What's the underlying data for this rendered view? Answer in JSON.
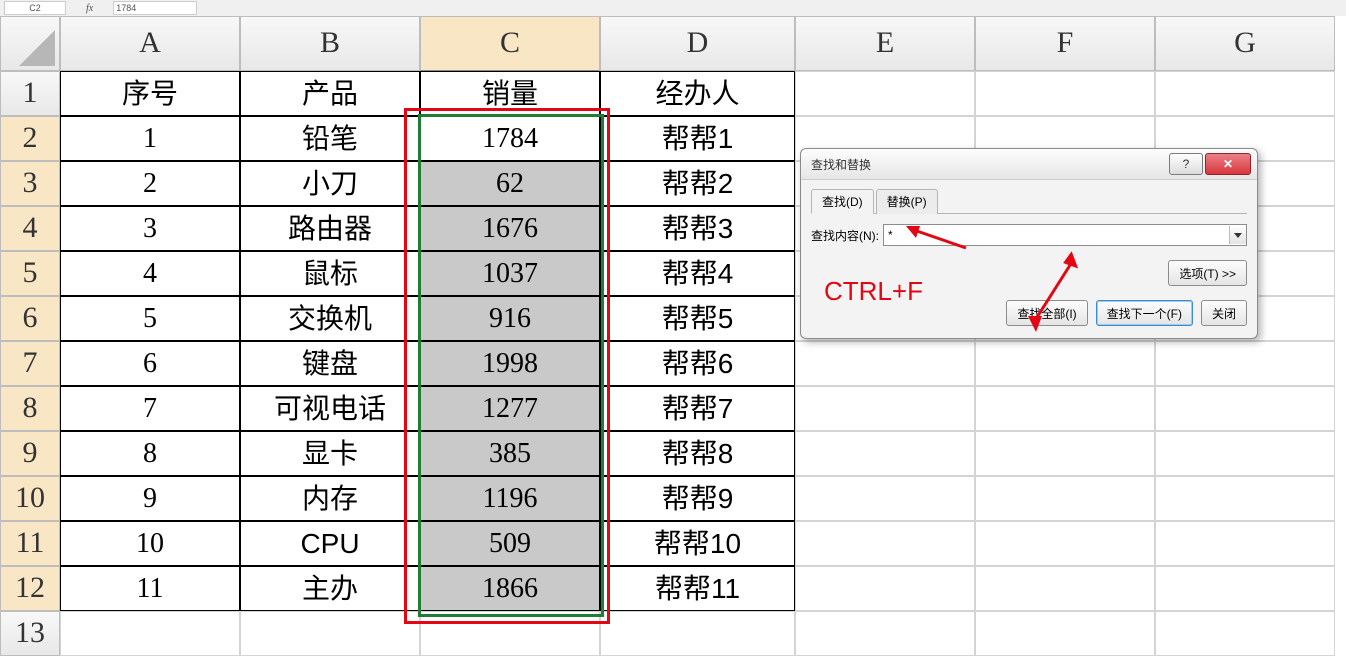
{
  "formula_bar": {
    "cell_ref": "C2",
    "fx_label": "fx",
    "formula_value": "1784"
  },
  "columns": [
    "A",
    "B",
    "C",
    "D",
    "E",
    "F",
    "G"
  ],
  "row_numbers": [
    1,
    2,
    3,
    4,
    5,
    6,
    7,
    8,
    9,
    10,
    11,
    12,
    13
  ],
  "table": {
    "headers": {
      "A": "序号",
      "B": "产品",
      "C": "销量",
      "D": "经办人"
    },
    "rows": [
      {
        "A": "1",
        "B": "铅笔",
        "C": "1784",
        "D": "帮帮1"
      },
      {
        "A": "2",
        "B": "小刀",
        "C": "62",
        "D": "帮帮2"
      },
      {
        "A": "3",
        "B": "路由器",
        "C": "1676",
        "D": "帮帮3"
      },
      {
        "A": "4",
        "B": "鼠标",
        "C": "1037",
        "D": "帮帮4"
      },
      {
        "A": "5",
        "B": "交换机",
        "C": "916",
        "D": "帮帮5"
      },
      {
        "A": "6",
        "B": "键盘",
        "C": "1998",
        "D": "帮帮6"
      },
      {
        "A": "7",
        "B": "可视电话",
        "C": "1277",
        "D": "帮帮7"
      },
      {
        "A": "8",
        "B": "显卡",
        "C": "385",
        "D": "帮帮8"
      },
      {
        "A": "9",
        "B": "内存",
        "C": "1196",
        "D": "帮帮9"
      },
      {
        "A": "10",
        "B": "CPU",
        "C": "509",
        "D": "帮帮10"
      },
      {
        "A": "11",
        "B": "主办",
        "C": "1866",
        "D": "帮帮11"
      }
    ]
  },
  "selection": {
    "col": "C",
    "from_row": 2,
    "to_row": 12
  },
  "dialog": {
    "title": "查找和替换",
    "tab_find": "查找(D)",
    "tab_replace": "替换(P)",
    "find_label": "查找内容(N):",
    "find_value": "*",
    "options_btn": "选项(T) >>",
    "find_all_btn": "查找全部(I)",
    "find_next_btn": "查找下一个(F)",
    "close_btn": "关闭",
    "help_symbol": "?",
    "close_symbol": "✕"
  },
  "annotation": {
    "shortcut_text": "CTRL+F"
  }
}
